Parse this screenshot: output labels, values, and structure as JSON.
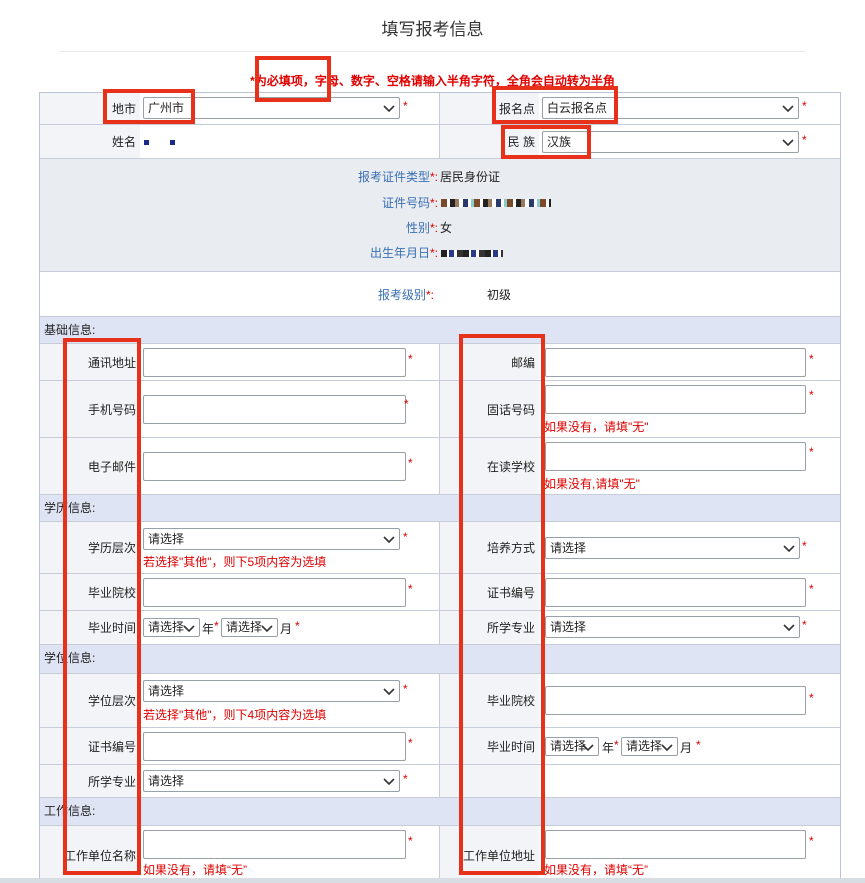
{
  "page": {
    "title": "填写报考信息",
    "notice": "*为必填项，字母、数字、空格请输入半角字符，全角会自动转为半角"
  },
  "top": {
    "city_label": "地市",
    "city_value": "广州市",
    "site_label": "报名点",
    "site_value": "白云报名点",
    "name_label": "姓名",
    "ethnic_label": "民 族",
    "ethnic_value": "汉族"
  },
  "identity": {
    "idtype_label": "报考证件类型",
    "idtype_value": "居民身份证",
    "idno_label": "证件号码",
    "gender_label": "性别",
    "gender_value": "女",
    "birth_label": "出生年月日",
    "level_label": "报考级别",
    "level_value": "初级"
  },
  "basic": {
    "section": "基础信息:",
    "address_label": "通讯地址",
    "postcode_label": "邮编",
    "mobile_label": "手机号码",
    "phone_label": "固话号码",
    "phone_hint": "如果没有，请填\"无\"",
    "email_label": "电子邮件",
    "school_label": "在读学校",
    "school_hint": "如果没有,请填\"无\""
  },
  "education": {
    "section": "学历信息:",
    "level_label": "学历层次",
    "level_value": "请选择",
    "level_hint": "若选择\"其他\"，则下5项内容为选填",
    "mode_label": "培养方式",
    "mode_value": "请选择",
    "school_label": "毕业院校",
    "cert_label": "证书编号",
    "time_label": "毕业时间",
    "year_value": "请选择",
    "year_unit": "年",
    "month_value": "请选择",
    "month_unit": "月",
    "major_label": "所学专业",
    "major_value": "请选择"
  },
  "degree": {
    "section": "学位信息:",
    "level_label": "学位层次",
    "level_value": "请选择",
    "level_hint": "若选择\"其他\"，则下4项内容为选填",
    "school_label": "毕业院校",
    "cert_label": "证书编号",
    "time_label": "毕业时间",
    "year_value": "请选择",
    "year_unit": "年",
    "month_value": "请选择",
    "month_unit": "月",
    "major_label": "所学专业",
    "major_value": "请选择"
  },
  "work": {
    "section": "工作信息:",
    "company_label": "工作单位名称",
    "company_hint": "如果没有，请填“无”",
    "address_label": "工作单位地址",
    "address_hint": "如果没有，请填“无”"
  },
  "common": {
    "required": "*",
    "colon_required": "*:"
  },
  "colors": {
    "accent_red": "#e00000",
    "highlight_box": "#e8311a",
    "label_blue": "#3a6fb3",
    "section_bg": "#dfe4f5"
  }
}
